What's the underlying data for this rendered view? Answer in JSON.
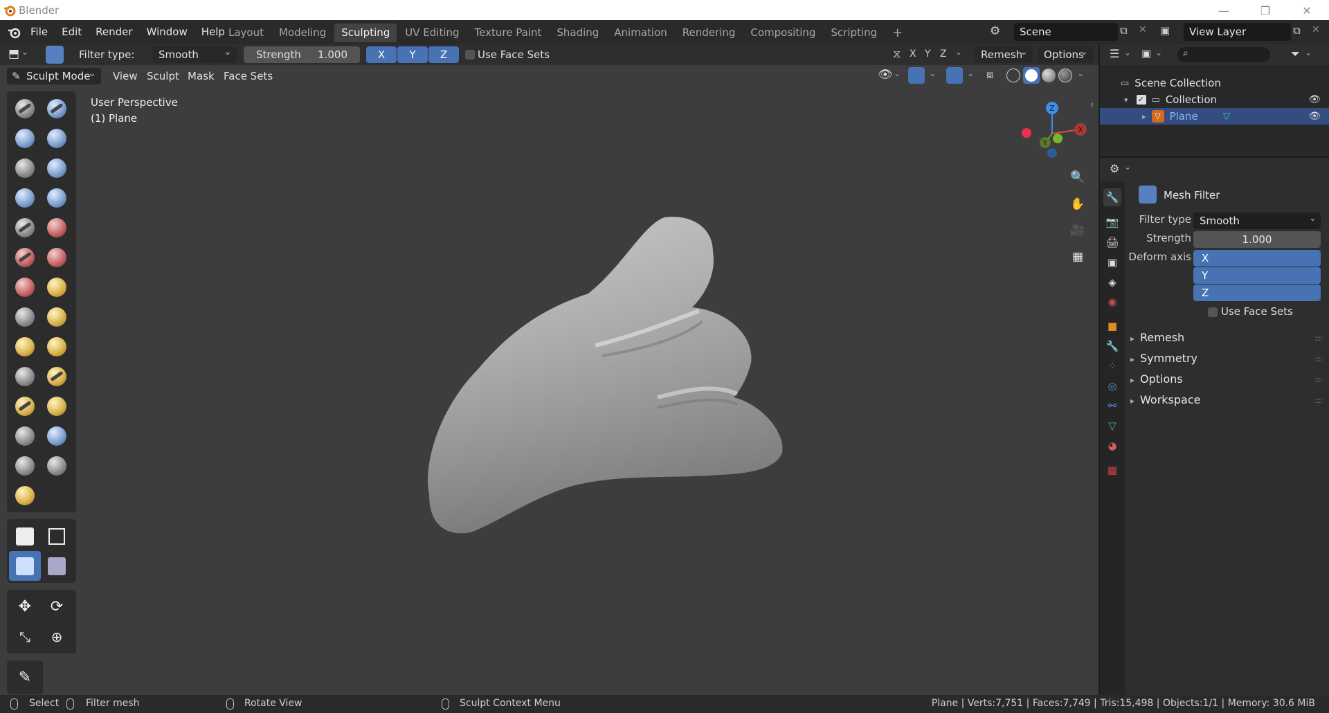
{
  "titlebar": {
    "app_name": "Blender",
    "min": "—",
    "max": "❐",
    "close": "✕"
  },
  "menu": [
    "File",
    "Edit",
    "Render",
    "Window",
    "Help"
  ],
  "workspaces": [
    {
      "label": "Layout",
      "active": false
    },
    {
      "label": "Modeling",
      "active": false
    },
    {
      "label": "Sculpting",
      "active": true
    },
    {
      "label": "UV Editing",
      "active": false
    },
    {
      "label": "Texture Paint",
      "active": false
    },
    {
      "label": "Shading",
      "active": false
    },
    {
      "label": "Animation",
      "active": false
    },
    {
      "label": "Rendering",
      "active": false
    },
    {
      "label": "Compositing",
      "active": false
    },
    {
      "label": "Scripting",
      "active": false
    }
  ],
  "add_workspace": "+",
  "scene": {
    "name": "Scene"
  },
  "view_layer": {
    "name": "View Layer"
  },
  "tool_header": {
    "filter_type_label": "Filter type:",
    "filter_type_value": "Smooth",
    "strength_label": "Strength",
    "strength_value": "1.000",
    "axis_x": "X",
    "axis_y": "Y",
    "axis_z": "Z",
    "use_face_sets": "Use Face Sets",
    "sym_x": "X",
    "sym_y": "Y",
    "sym_z": "Z",
    "remesh": "Remesh",
    "options": "Options"
  },
  "mode_header": {
    "mode": "Sculpt Mode",
    "view": "View",
    "sculpt": "Sculpt",
    "mask": "Mask",
    "face_sets": "Face Sets"
  },
  "viewport": {
    "perspective": "User Perspective",
    "object": "(1) Plane",
    "gizmo_x": "X",
    "gizmo_y": "Y",
    "gizmo_z": "Z"
  },
  "outliner": {
    "scene_collection": "Scene Collection",
    "collection": "Collection",
    "object": "Plane"
  },
  "properties": {
    "panel_title": "Mesh Filter",
    "filter_type_label": "Filter type",
    "filter_type_value": "Smooth",
    "strength_label": "Strength",
    "strength_value": "1.000",
    "deform_axis_label": "Deform axis",
    "axis_x": "X",
    "axis_y": "Y",
    "axis_z": "Z",
    "use_face_sets": "Use Face Sets",
    "panels": [
      "Remesh",
      "Symmetry",
      "Options",
      "Workspace"
    ]
  },
  "statusbar": {
    "select": "Select",
    "filter_mesh": "Filter mesh",
    "rotate_view": "Rotate View",
    "context_menu": "Sculpt Context Menu",
    "stats": "Plane | Verts:7,751 | Faces:7,749 | Tris:15,498 | Objects:1/1 | Memory: 30.6 MiB"
  },
  "colors": {
    "accent": "#4772b3",
    "selected_row": "#334d80",
    "viewport_bg": "#3d3d3d"
  }
}
